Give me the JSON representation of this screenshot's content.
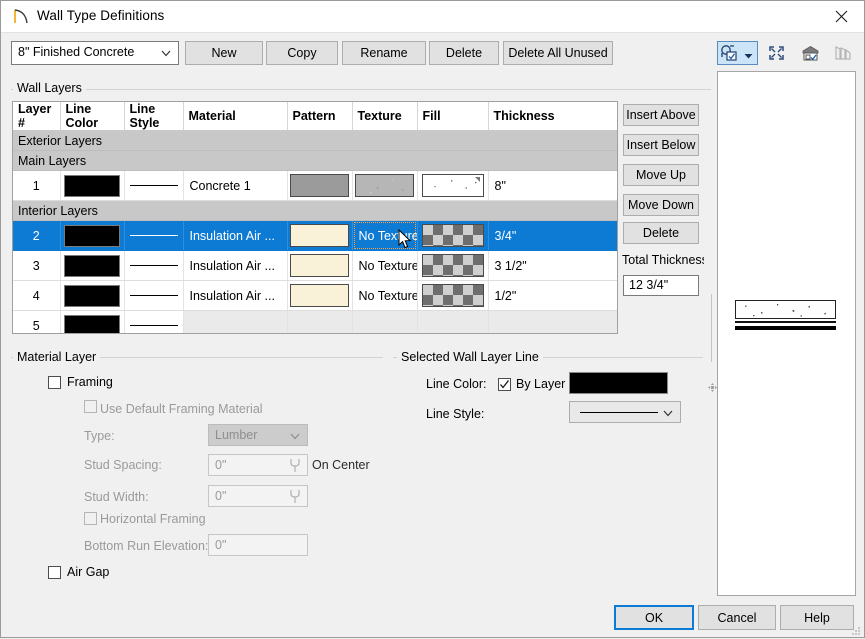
{
  "window": {
    "title": "Wall Type Definitions",
    "title_icon": "wall-arc-icon",
    "close_icon": "close-icon"
  },
  "toolbar": {
    "wall_type_value": "8\" Finished Concrete",
    "wall_type_chevron": "chevron-down-icon",
    "new_label": "New",
    "copy_label": "Copy",
    "rename_label": "Rename",
    "delete_label": "Delete",
    "delete_all_unused_label": "Delete All Unused"
  },
  "wall_layers": {
    "group_label": "Wall Layers",
    "columns": [
      "Layer #",
      "Line Color",
      "Line Style",
      "Material",
      "Pattern",
      "Texture",
      "Fill",
      "Thickness"
    ],
    "groups": {
      "exterior": "Exterior Layers",
      "main": "Main Layers",
      "interior": "Interior Layers"
    },
    "rows": [
      {
        "num": "1",
        "line_color": "#000000",
        "line_style": "solid",
        "material": "Concrete 1",
        "pattern": "#9b9b9b",
        "texture": "concrete-texture",
        "texture_label": "",
        "fill": "dots-fill",
        "thickness": "8\"",
        "selected": false
      },
      {
        "num": "2",
        "line_color": "#000000",
        "line_style": "solid",
        "material": "Insulation  Air ...",
        "pattern": "#faf2d8",
        "texture": "no-texture",
        "texture_label": "No Texture",
        "fill": "checker-fill",
        "thickness": "3/4\"",
        "selected": true
      },
      {
        "num": "3",
        "line_color": "#000000",
        "line_style": "solid",
        "material": "Insulation  Air ...",
        "pattern": "#faf2d8",
        "texture": "no-texture",
        "texture_label": "No Texture",
        "fill": "checker-fill",
        "thickness": "3 1/2\"",
        "selected": false
      },
      {
        "num": "4",
        "line_color": "#000000",
        "line_style": "solid",
        "material": "Insulation  Air ...",
        "pattern": "#faf2d8",
        "texture": "no-texture",
        "texture_label": "No Texture",
        "fill": "checker-fill",
        "thickness": "1/2\"",
        "selected": false
      },
      {
        "num": "5",
        "line_color": "#000000",
        "line_style": "solid",
        "material": "",
        "pattern": "",
        "texture": "",
        "texture_label": "",
        "fill": "",
        "thickness": "",
        "selected": false
      }
    ]
  },
  "side_buttons": {
    "insert_above": "Insert Above",
    "insert_below": "Insert Below",
    "move_up": "Move Up",
    "move_down": "Move Down",
    "delete": "Delete",
    "total_thickness_label": "Total Thickness",
    "total_thickness_value": "12 3/4\""
  },
  "preview": {
    "toolbar_icons": [
      "camera-toggle-icon",
      "fit-to-window-icon",
      "elevation-view-icon",
      "layers-icon"
    ],
    "camera_dropdown_icon": "chevron-down-icon"
  },
  "material_layer": {
    "group_label": "Material Layer",
    "framing_label": "Framing",
    "framing_checked": false,
    "use_default_framing_material_label": "Use Default Framing Material",
    "use_default_framing_material_checked": false,
    "type_label": "Type:",
    "type_value": "Lumber",
    "type_chevron": "chevron-down-icon",
    "stud_spacing_label": "Stud Spacing:",
    "stud_spacing_value": "0\"",
    "on_center_label": "On Center",
    "stud_width_label": "Stud Width:",
    "stud_width_value": "0\"",
    "horizontal_framing_label": "Horizontal Framing",
    "horizontal_framing_checked": false,
    "bottom_run_elevation_label": "Bottom Run Elevation:",
    "bottom_run_elevation_value": "0\"",
    "air_gap_label": "Air Gap",
    "air_gap_checked": false,
    "spinner_icon": "spinner-wrench-icon"
  },
  "selected_wall_layer_line": {
    "group_label": "Selected Wall Layer Line",
    "line_color_label": "Line Color:",
    "by_layer_label": "By Layer",
    "by_layer_checked": true,
    "color_value": "#000000",
    "line_style_label": "Line Style:",
    "line_style_value": "solid",
    "line_style_chevron": "chevron-down-icon"
  },
  "footer": {
    "ok_label": "OK",
    "cancel_label": "Cancel",
    "help_label": "Help"
  },
  "colors": {
    "accent": "#0d7bd4",
    "dialog_bg": "#f0f0f0",
    "button_bg": "#e1e1e1",
    "group_row_bg": "#c8c8c8"
  }
}
